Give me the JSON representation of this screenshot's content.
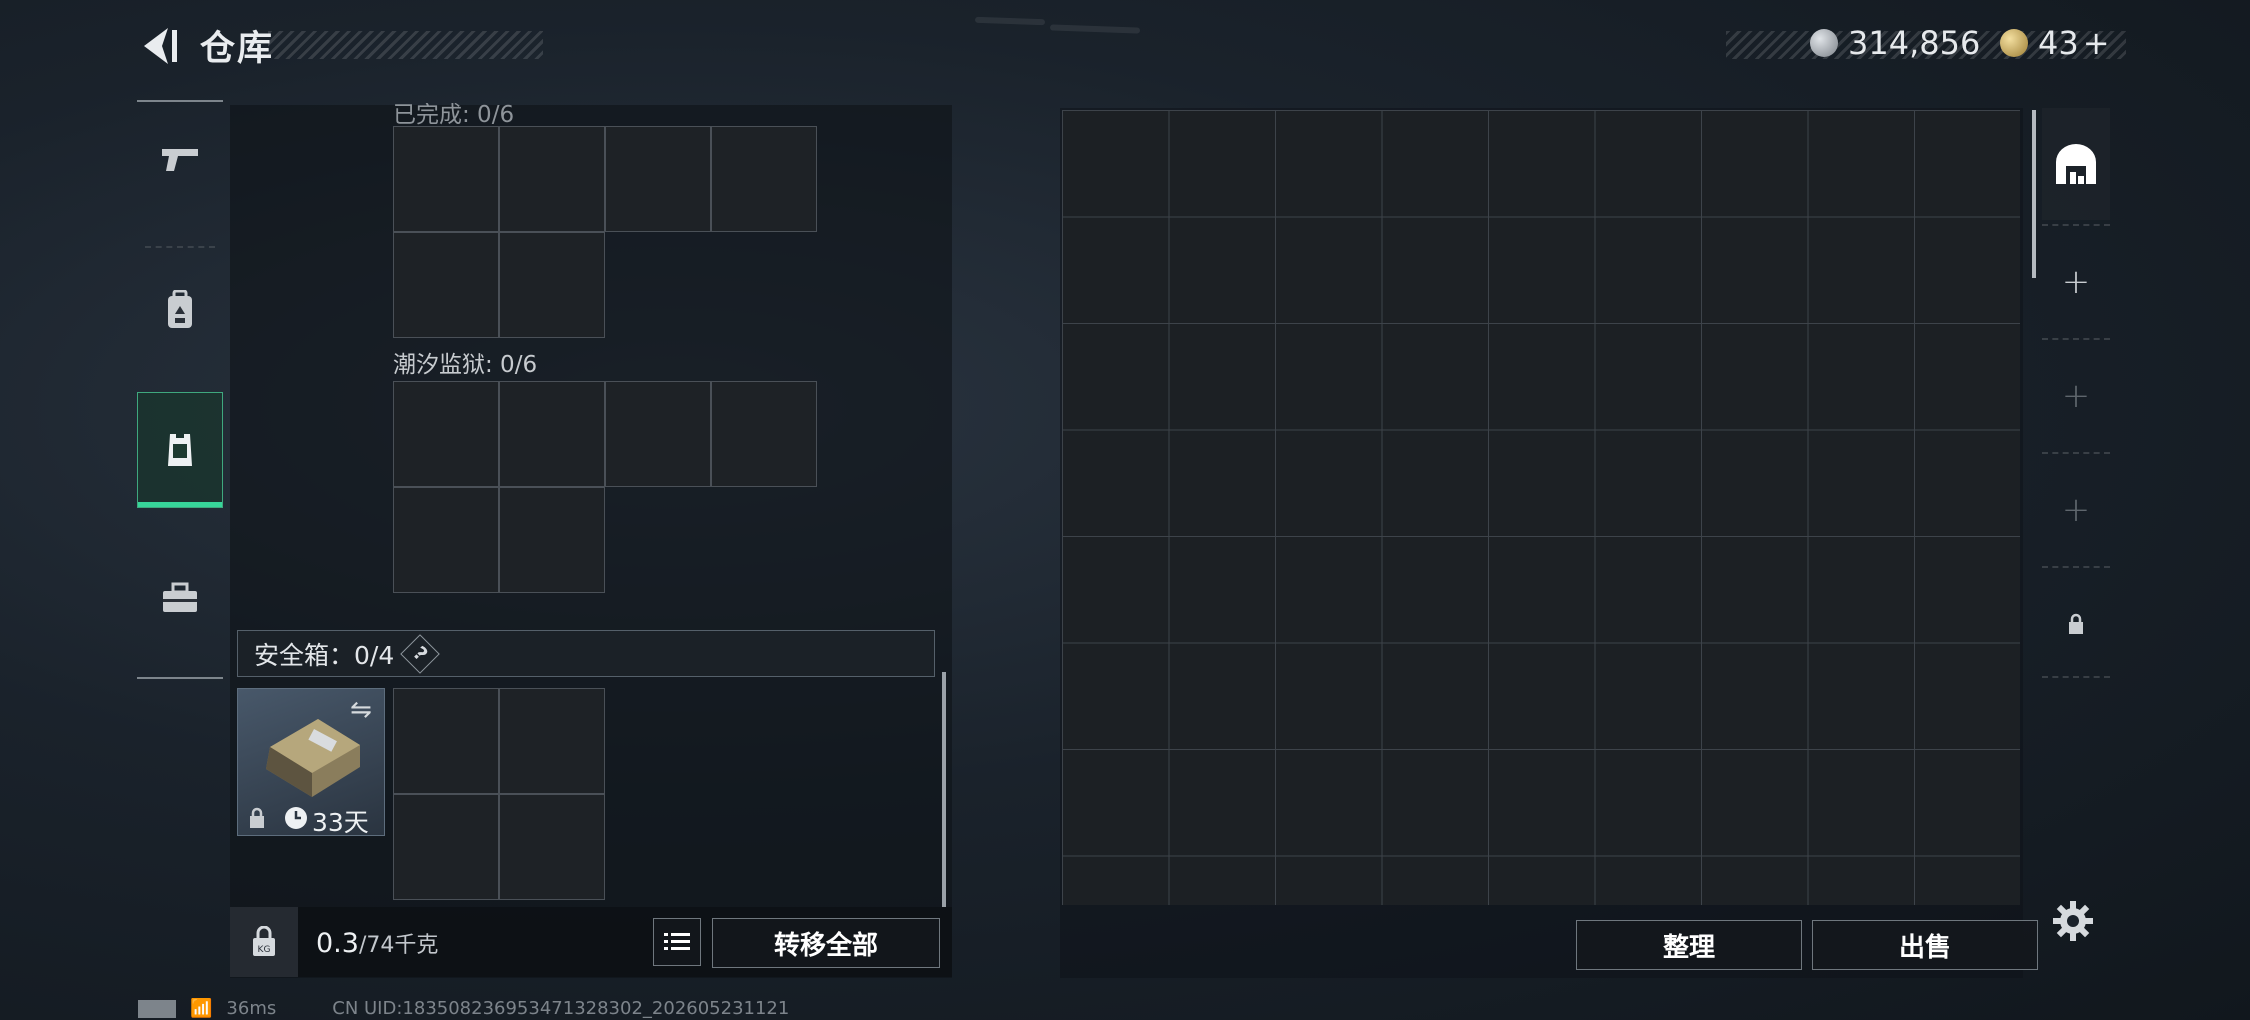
{
  "header": {
    "title": "仓库",
    "currency_amount": "314,856",
    "premium_amount": "43",
    "premium_add": "+"
  },
  "left_nav": {
    "items": [
      "pistol-icon",
      "backpack-icon",
      "vest-icon",
      "toolbox-icon"
    ],
    "active_index": 2
  },
  "containers": [
    {
      "label": "已完成: 0/6"
    },
    {
      "label": "潮汐监狱: 0/6"
    }
  ],
  "safe_box": {
    "label": "安全箱：0/4",
    "help": "?",
    "days_left": "33天"
  },
  "footer": {
    "weight_value": "0.3",
    "weight_capacity": "/74千克",
    "transfer_all": "转移全部"
  },
  "warehouse": {
    "sort_button": "整理",
    "sell_button": "出售",
    "side_buttons": [
      "warehouse-icon",
      "+",
      "+",
      "+",
      "lock-icon"
    ]
  },
  "status_bar": {
    "ping": "36ms",
    "uid": "CN UID:1835082369534713283­02_202605231121"
  },
  "colors": {
    "accent_green": "#37d69a",
    "panel_bg": "#1c2024",
    "grid_line": "#3d434a"
  }
}
